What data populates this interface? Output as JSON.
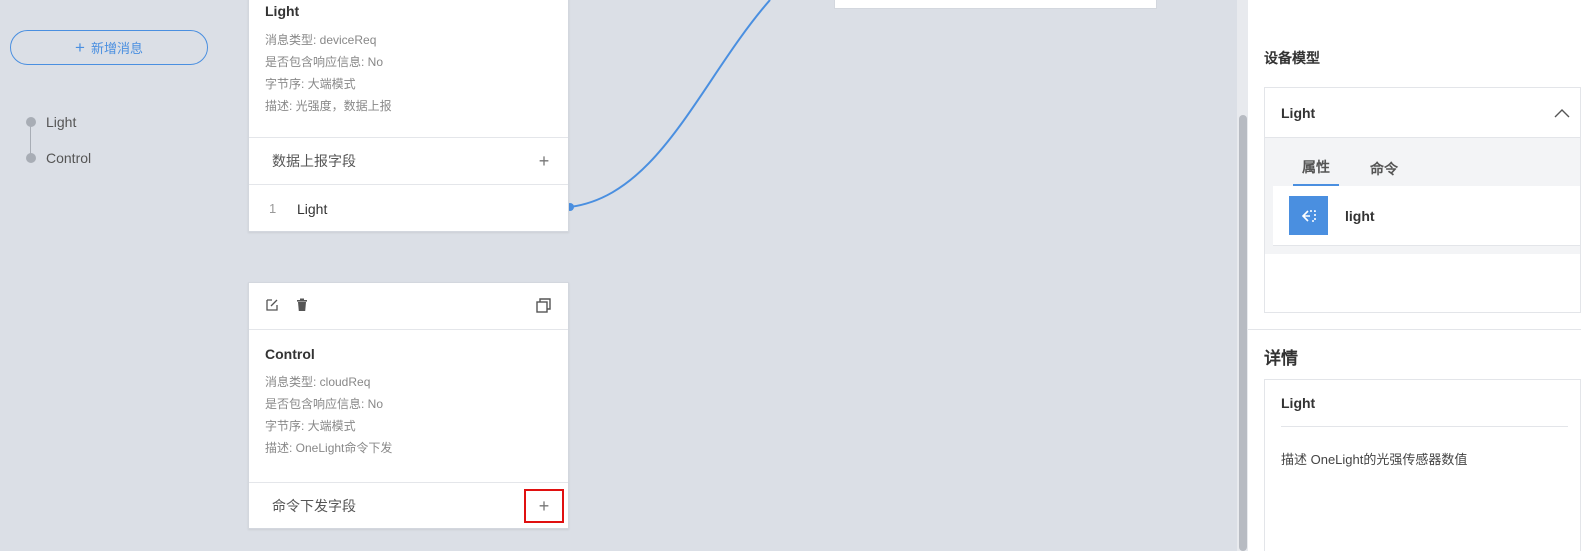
{
  "nav": {
    "add_button_label": "新增消息",
    "items": [
      "Light",
      "Control"
    ]
  },
  "card_light": {
    "title": "Light",
    "lines": [
      "消息类型: deviceReq",
      "是否包含响应信息: No",
      "字节序: 大端模式",
      "描述: 光强度，数据上报"
    ],
    "field_header": "数据上报字段",
    "fields": [
      {
        "index": "1",
        "name": "Light"
      }
    ]
  },
  "card_control": {
    "title": "Control",
    "lines": [
      "消息类型: cloudReq",
      "是否包含响应信息: No",
      "字节序: 大端模式",
      "描述: OneLight命令下发"
    ],
    "field_header": "命令下发字段"
  },
  "right": {
    "model_title": "设备模型",
    "model_name": "Light",
    "tabs": [
      "属性",
      "命令"
    ],
    "property": "light",
    "detail_title": "详情",
    "detail_name": "Light",
    "detail_desc": "描述 OneLight的光强传感器数值"
  },
  "colors": {
    "accent": "#4a8fe0",
    "highlight": "#e01010",
    "canvas": "#dbdfe6"
  }
}
